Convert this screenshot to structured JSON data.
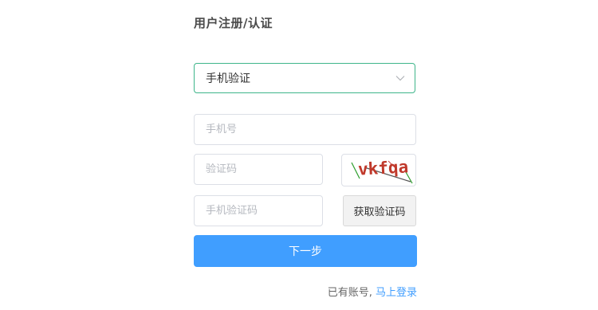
{
  "form": {
    "title": "用户注册/认证",
    "verify_type": {
      "selected": "手机验证",
      "icon": "chevron-down-icon"
    },
    "phone_placeholder": "手机号",
    "captcha_placeholder": "验证码",
    "captcha_text": "vkfqa",
    "sms_code_placeholder": "手机验证码",
    "get_code_button": "获取验证码",
    "next_button": "下一步",
    "footer_text": "已有账号,",
    "login_link": "马上登录"
  },
  "colors": {
    "accent": "#409eff",
    "select_border": "#3eb58a",
    "captcha_text": "#c0392b"
  }
}
